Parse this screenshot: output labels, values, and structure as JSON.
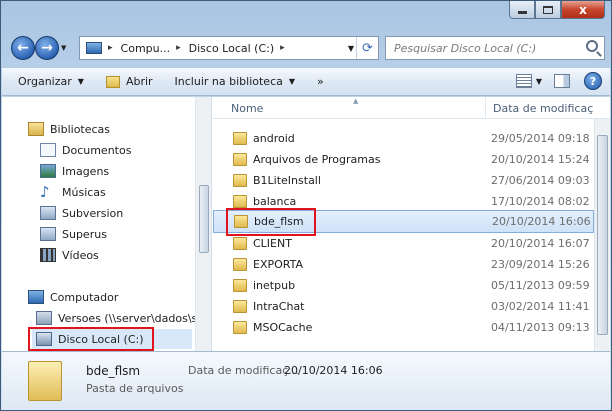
{
  "window": {
    "close_glyph": "x"
  },
  "address_bar": {
    "crumbs": [
      "Compu...",
      "Disco Local (C:)"
    ]
  },
  "search": {
    "placeholder": "Pesquisar Disco Local (C:)"
  },
  "toolbar": {
    "organize_label": "Organizar",
    "open_label": "Abrir",
    "include_label": "Incluir na biblioteca",
    "more_label": "»"
  },
  "sidebar": {
    "libraries_label": "Bibliotecas",
    "library_items": [
      "Documentos",
      "Imagens",
      "Músicas",
      "Subversion",
      "Superus",
      "Vídeos"
    ],
    "computer_label": "Computador",
    "computer_items": [
      "Versoes (\\\\server\\dados\\s",
      "Disco Local (C:)"
    ],
    "selected": "Disco Local (C:)"
  },
  "file_list": {
    "columns": [
      "Nome",
      "Data de modificaç"
    ],
    "rows": [
      {
        "name": "android",
        "date": "29/05/2014 09:18"
      },
      {
        "name": "Arquivos de Programas",
        "date": "20/10/2014 15:24"
      },
      {
        "name": "B1LiteInstall",
        "date": "27/06/2014 09:03"
      },
      {
        "name": "balanca",
        "date": "17/10/2014 08:02"
      },
      {
        "name": "bde_flsm",
        "date": "20/10/2014 16:06"
      },
      {
        "name": "CLIENT",
        "date": "20/10/2014 16:07"
      },
      {
        "name": "EXPORTA",
        "date": "23/09/2014 15:26"
      },
      {
        "name": "inetpub",
        "date": "05/11/2013 09:59"
      },
      {
        "name": "IntraChat",
        "date": "03/02/2014 11:41"
      },
      {
        "name": "MSOCache",
        "date": "04/11/2013 09:13"
      }
    ],
    "selected": "bde_flsm"
  },
  "details": {
    "name": "bde_flsm",
    "type": "Pasta de arquivos",
    "date_label": "Data de modificaç...",
    "date_value": "20/10/2014 16:06"
  },
  "colors": {
    "highlight": "#e0141e",
    "selection": "#cfe2f8",
    "accent": "#2f6bb4"
  }
}
